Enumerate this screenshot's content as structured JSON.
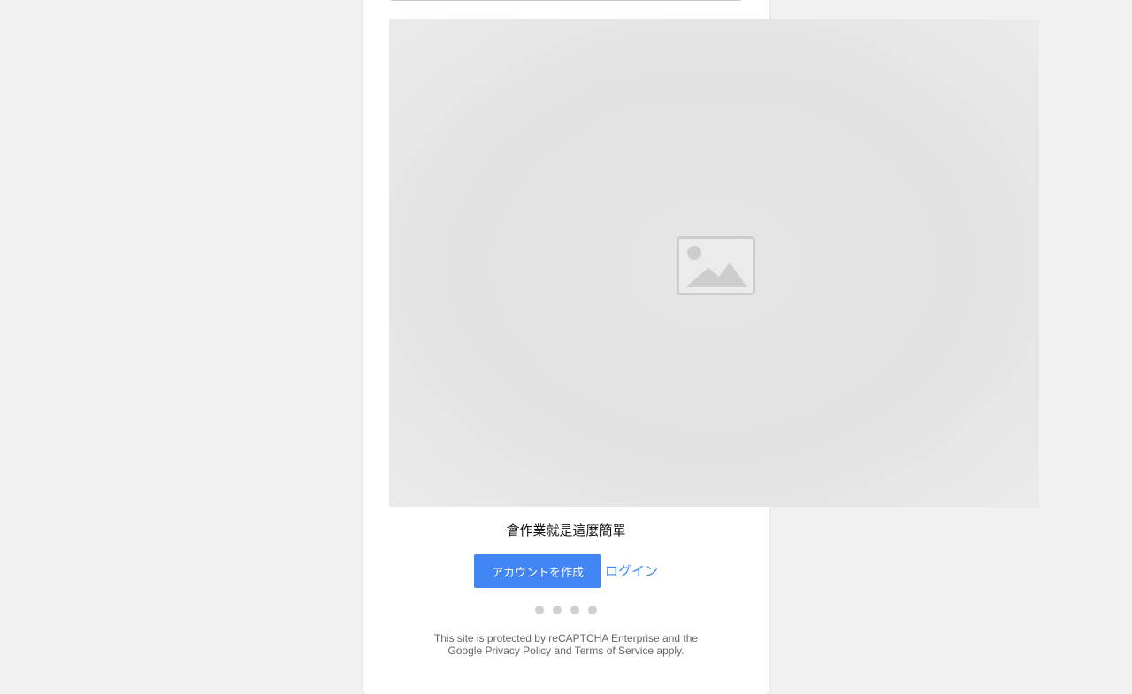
{
  "slide": {
    "image_icon": "image-placeholder-icon",
    "caption": "會作業就是這麼簡單"
  },
  "actions": {
    "create_account_label": "アカウントを作成",
    "login_label": "ログイン"
  },
  "carousel": {
    "dot_count": 4
  },
  "recaptcha": {
    "line1": "This site is protected by reCAPTCHA Enterprise and the",
    "google_label": "Google",
    "privacy_label": "Privacy Policy",
    "and_label": "and",
    "terms_label": "Terms of Service",
    "apply_label": "apply."
  },
  "colors": {
    "accent": "#4285f4",
    "background": "#f1f1f1",
    "panel": "#ffffff",
    "dot": "#cfcfcf"
  }
}
